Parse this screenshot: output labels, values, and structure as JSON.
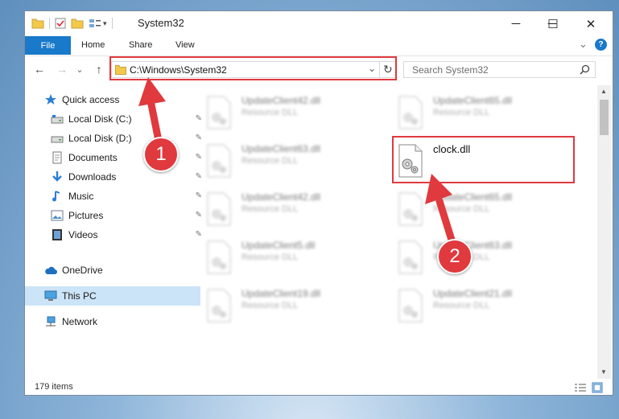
{
  "window": {
    "title": "System32",
    "minimize_glyph": "─",
    "maximize_glyph": "☐",
    "close_glyph": "✕"
  },
  "ribbon": {
    "tabs": [
      "File",
      "Home",
      "Share",
      "View"
    ],
    "help_glyph": "?",
    "expand_glyph": "⌄"
  },
  "nav": {
    "back": "←",
    "forward": "→",
    "recent": "⌄",
    "up": "↑"
  },
  "address": {
    "path": "C:\\Windows\\System32",
    "dropdown_glyph": "⌄",
    "refresh_glyph": "↻"
  },
  "search": {
    "placeholder": "Search System32"
  },
  "sidebar": {
    "items": [
      {
        "label": "Quick access",
        "icon": "star-icon"
      },
      {
        "label": "Local Disk (C:)",
        "icon": "drive-icon",
        "pinned": true
      },
      {
        "label": "Local Disk (D:)",
        "icon": "drive-icon",
        "pinned": true
      },
      {
        "label": "Documents",
        "icon": "documents-icon",
        "pinned": true
      },
      {
        "label": "Downloads",
        "icon": "download-icon",
        "pinned": true
      },
      {
        "label": "Music",
        "icon": "music-icon",
        "pinned": true
      },
      {
        "label": "Pictures",
        "icon": "pictures-icon",
        "pinned": true
      },
      {
        "label": "Videos",
        "icon": "videos-icon",
        "pinned": true
      },
      {
        "label": "OneDrive",
        "icon": "cloud-icon"
      },
      {
        "label": "This PC",
        "icon": "computer-icon",
        "selected": true
      },
      {
        "label": "Network",
        "icon": "network-icon"
      }
    ],
    "pin_glyph": "📌"
  },
  "files": {
    "left": [
      {
        "name": "UpdateClient42.dll",
        "type": "Resource DLL"
      },
      {
        "name": "UpdateClient63.dll",
        "type": "Resource DLL"
      },
      {
        "name": "UpdateClient42.dll",
        "type": "Resource DLL"
      },
      {
        "name": "UpdateClient5.dll",
        "type": "Resource DLL"
      },
      {
        "name": "UpdateClient19.dll",
        "type": "Resource DLL"
      }
    ],
    "right": [
      {
        "name": "UpdateClient65.dll",
        "type": "Resource DLL"
      },
      {
        "name": "clock.dll",
        "type": "",
        "highlighted": true
      },
      {
        "name": "UpdateClient65.dll",
        "type": "Resource DLL"
      },
      {
        "name": "UpdateClient63.dll",
        "type": "Resource DLL"
      },
      {
        "name": "UpdateClient21.dll",
        "type": "Resource DLL"
      }
    ]
  },
  "status": {
    "item_count": "179 items"
  },
  "annotations": {
    "step1": "1",
    "step2": "2",
    "color": "#e0393e"
  }
}
